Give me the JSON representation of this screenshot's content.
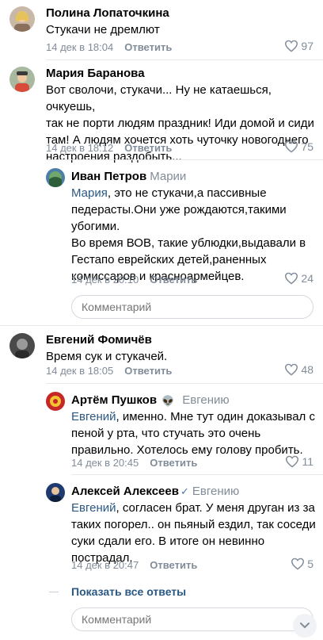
{
  "comments": [
    {
      "author": "Полина Лопаточкина",
      "lines": [
        "Стукачи не дремлют"
      ],
      "date": "14 дек в 18:04",
      "reply_label": "Ответить",
      "likes": "97"
    },
    {
      "author": "Мария Баранова",
      "lines": [
        "Вот сволочи, стукачи... Ну не катаешься, очкуешь,",
        "так не порти людям праздник!  Иди домой и сиди",
        "там!  А людям хочется хоть чуточку новогоднего",
        "настроения раздобыть..."
      ],
      "date": "14 дек в 18:12",
      "reply_label": "Ответить",
      "likes": "75",
      "replies": [
        {
          "author": "Иван Петров",
          "reply_to": "Марии",
          "mention": "Мария",
          "lines": [
            ", это не стукачи,а пассивные",
            "педерасты.Они уже рождаются,такими",
            "убогими.",
            "Во время ВОВ, такие ублюдки,выдавали в",
            "Гестапо еврейских детей,раненных",
            "комиссаров и красноармейцев."
          ],
          "date": "14 дек в 20:10",
          "reply_label": "Ответить",
          "likes": "24"
        }
      ],
      "comment_placeholder": "Комментарий"
    },
    {
      "author": "Евгений Фомичёв",
      "lines": [
        "Время сук и стукачей."
      ],
      "date": "14 дек в 18:05",
      "reply_label": "Ответить",
      "likes": "48",
      "replies": [
        {
          "author": "Артём Пушков",
          "badge": "👽",
          "reply_to": "Евгению",
          "mention": "Евгений",
          "lines": [
            ", именно.  Мне тут один доказывал с",
            "пеной у рта, что стучать это очень",
            "правильно.  Хотелось ему голову пробить."
          ],
          "date": "14 дек в 20:45",
          "reply_label": "Ответить",
          "likes": "11"
        },
        {
          "author": "Алексей Алексеев",
          "verified": "✓",
          "reply_to": "Евгению",
          "mention": "Евгений",
          "lines": [
            ", согласен брат. У меня друган из за",
            "таких погорел..  он пьяный ездил, так соседи",
            "суки сдали его. В итоге он невинно",
            "пострадал."
          ],
          "date": "14 дек в 20:47",
          "reply_label": "Ответить",
          "likes": "5"
        }
      ],
      "show_all_label": "Показать все ответы",
      "comment_placeholder": "Комментарий"
    }
  ],
  "icons": {
    "like": "heart-outline-icon",
    "scroll": "chevron-down-icon",
    "verified": "checkmark-icon"
  },
  "colors": {
    "link": "#2a5885",
    "meta": "#818c99",
    "divider": "#e7e8ec"
  }
}
